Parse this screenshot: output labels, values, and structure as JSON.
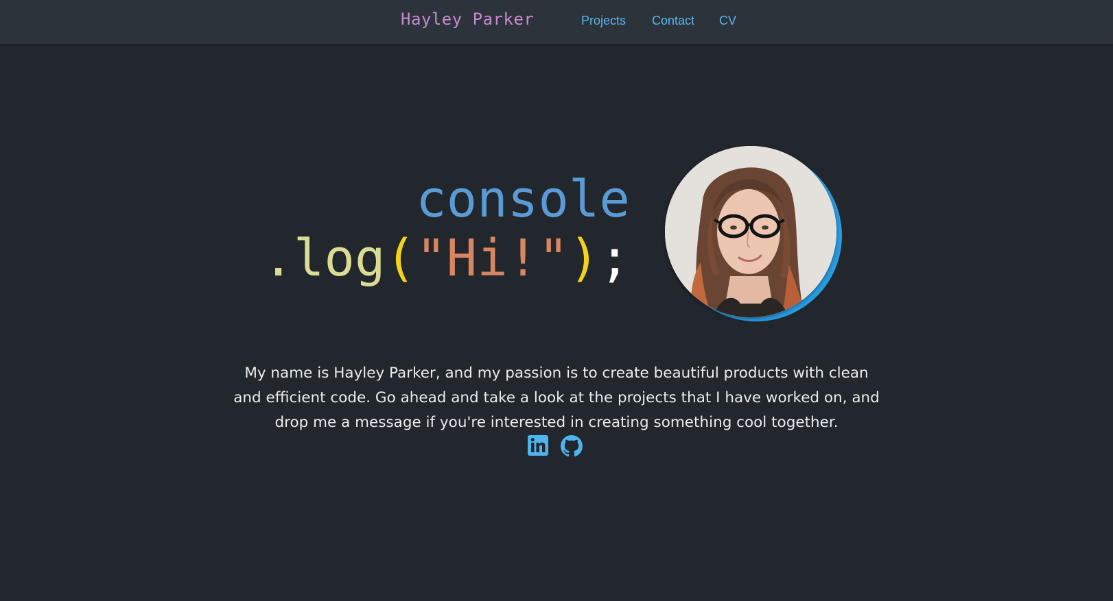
{
  "nav": {
    "brand": "Hayley Parker",
    "links": [
      {
        "label": "Projects"
      },
      {
        "label": "Contact"
      },
      {
        "label": "CV"
      }
    ]
  },
  "hero": {
    "code": {
      "line1": "console",
      "dot_log": ".log",
      "open_paren": "(",
      "string": "\"Hi!\"",
      "close_paren": ")",
      "semicolon": ";"
    },
    "avatar_alt": "Portrait photo of Hayley Parker"
  },
  "bio": {
    "text": "My name is Hayley Parker, and my passion is to create beautiful products with clean and efficient code. Go ahead and take a look at the projects that I have worked on, and drop me a message if you're interested in creating something cool together."
  },
  "socials": [
    {
      "icon": "linkedin-icon"
    },
    {
      "icon": "github-icon"
    }
  ],
  "colors": {
    "background": "#22262d",
    "navbar": "#2d333b",
    "brand": "#c78ad0",
    "link": "#57b6ee",
    "console": "#5a9bd5",
    "log": "#dadb94",
    "paren": "#f2d31a",
    "string": "#d88562",
    "avatar_ring": "#2a9be0"
  }
}
